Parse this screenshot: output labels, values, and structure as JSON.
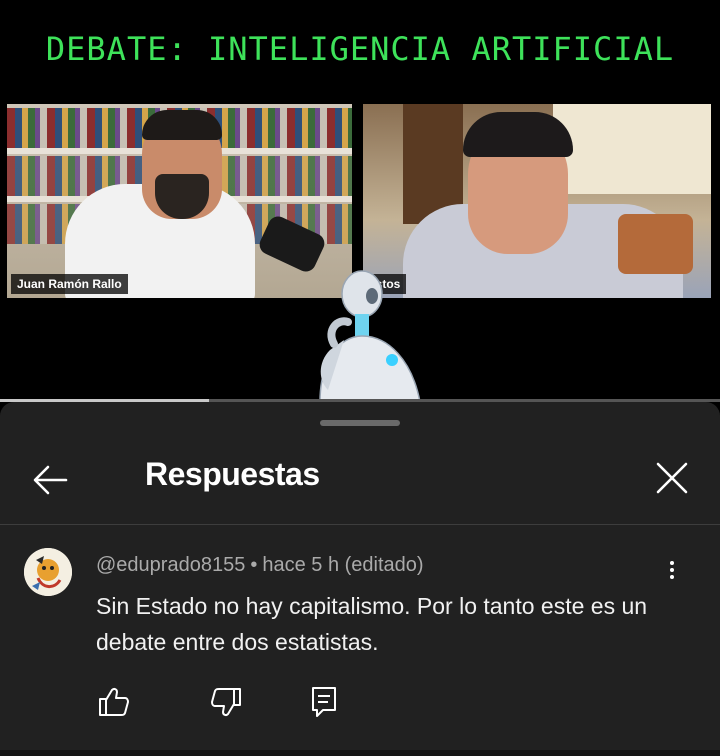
{
  "video": {
    "title": "DEBATE: INTELIGENCIA ARTIFICIAL",
    "left_speaker": "Juan Ramón Rallo",
    "right_speaker": "astos",
    "progress_fraction": 0.29
  },
  "panel": {
    "title": "Respuestas",
    "back_icon": "arrow-left-icon",
    "close_icon": "close-x-icon"
  },
  "comment": {
    "author": "@eduprado8155",
    "separator": "•",
    "time": "hace 5 h (editado)",
    "text": "Sin Estado no hay capitalismo. Por lo tanto este es un debate entre dos estatistas.",
    "actions": [
      "thumbs-up-icon",
      "thumbs-down-icon",
      "reply-icon"
    ]
  },
  "colors": {
    "title_green": "#3ee25a",
    "panel_bg": "#212121",
    "meta_gray": "#aaaaaa"
  }
}
